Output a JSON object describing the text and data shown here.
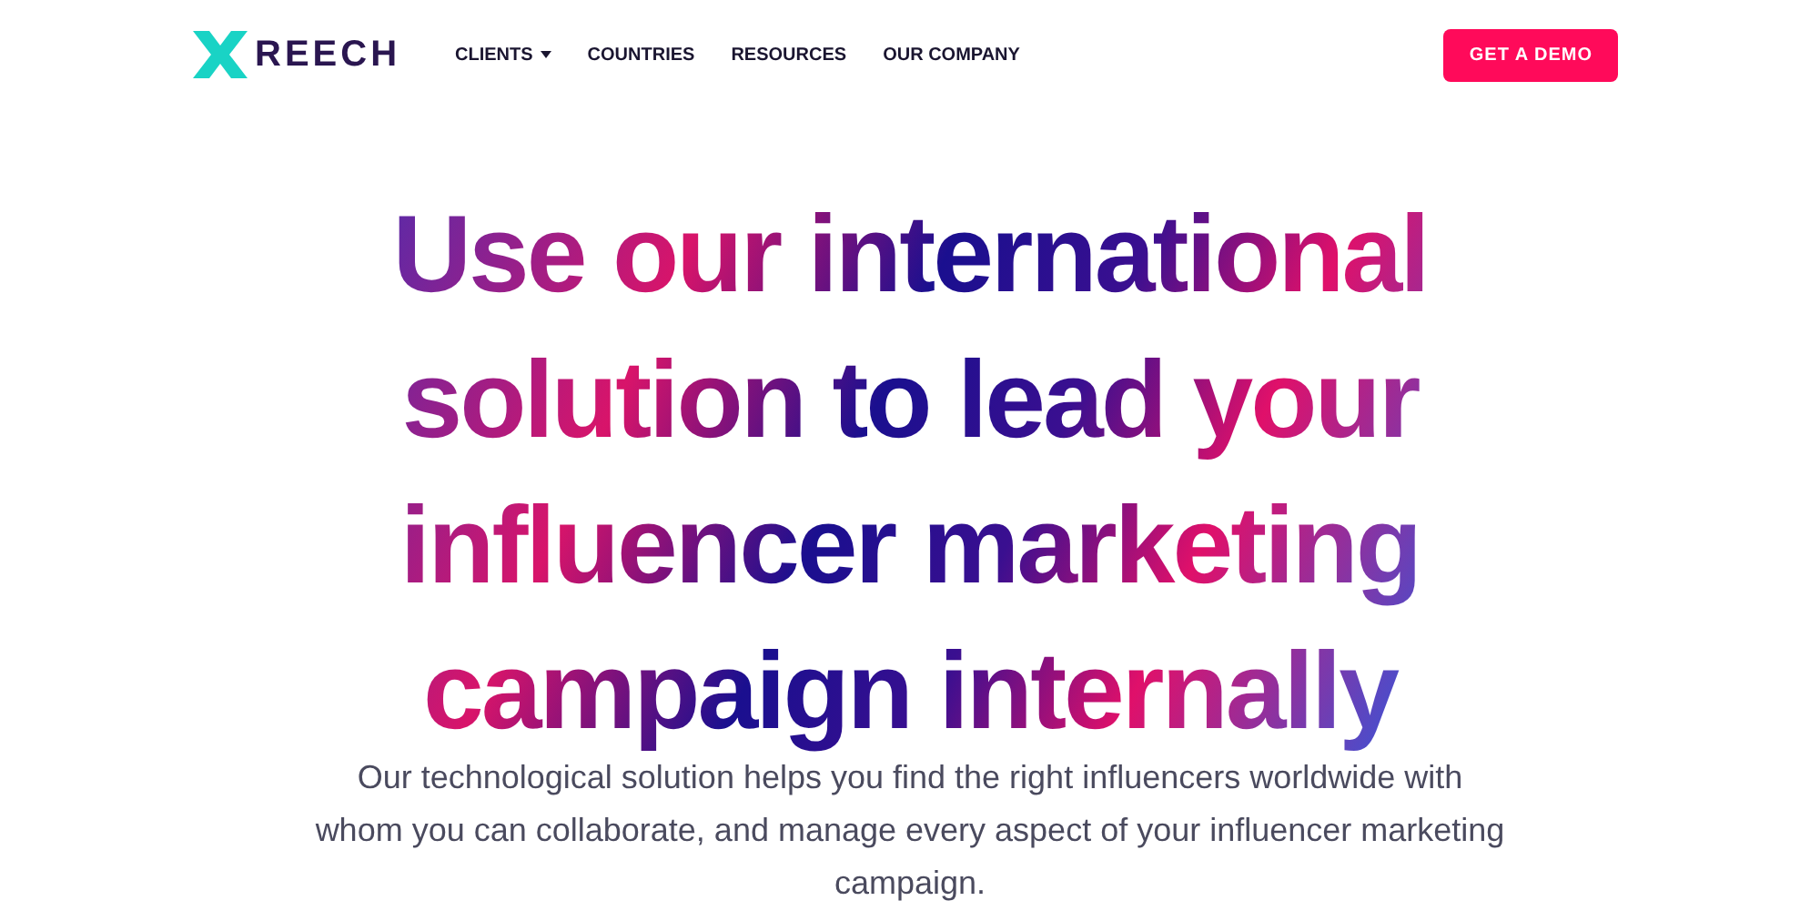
{
  "header": {
    "logo_text": "REECH",
    "nav": [
      {
        "label": "CLIENTS",
        "dropdown": true
      },
      {
        "label": "COUNTRIES",
        "dropdown": false
      },
      {
        "label": "RESOURCES",
        "dropdown": false
      },
      {
        "label": "OUR COMPANY",
        "dropdown": false
      }
    ],
    "cta": "GET A DEMO"
  },
  "hero": {
    "headline_lines": [
      "Use our international",
      "solution to lead your",
      "influencer marketing",
      "campaign internally"
    ],
    "description": "Our technological solution helps you find the right influencers worldwide with whom you can collaborate, and manage every aspect of your influencer marketing campaign."
  }
}
